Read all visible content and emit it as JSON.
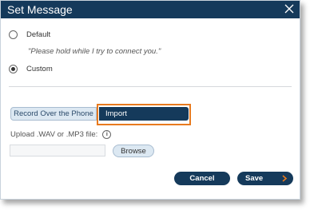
{
  "dialog": {
    "title": "Set Message",
    "close_icon": "close-icon"
  },
  "options": {
    "default_label": "Default",
    "default_checked": false,
    "hold_message": "\"Please hold while I try to connect you.\"",
    "custom_label": "Custom",
    "custom_checked": true
  },
  "tabs": {
    "record_label": "Record Over the Phone",
    "import_label": "Import",
    "active": "Import"
  },
  "upload": {
    "label": "Upload .WAV or .MP3 file:",
    "info_icon": "info-icon",
    "file_value": "",
    "browse_label": "Browse"
  },
  "footer": {
    "cancel_label": "Cancel",
    "save_label": "Save",
    "save_icon": "chevron-right-icon"
  },
  "colors": {
    "titlebar": "#153a5b",
    "highlight": "#e87a1e",
    "tab_inactive": "#dce8f2"
  }
}
